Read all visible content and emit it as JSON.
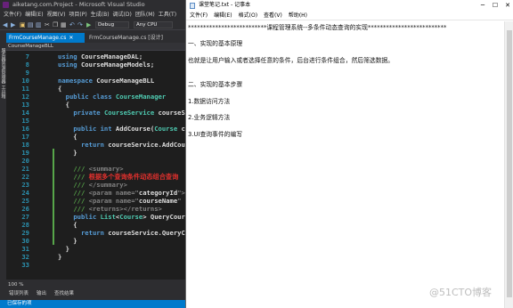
{
  "vs": {
    "title": "aiketang.com.Project - Microsoft Visual Studio",
    "menu": [
      "文件(F)",
      "编辑(E)",
      "视图(V)",
      "项目(P)",
      "生成(B)",
      "调试(D)",
      "团队(M)",
      "工具(T)"
    ],
    "config": "Debug",
    "platform": "Any CPU",
    "tabs": [
      {
        "label": "FrmCourseManage.cs",
        "active": true
      },
      {
        "label": "FrmCourseManage.cs [设计]",
        "active": false
      }
    ],
    "sidestrip_label": "服务器资源管理器 工具箱",
    "nav_class": "CourseManageBLL",
    "code": [
      {
        "n": "7",
        "parts": [
          [
            "kw",
            "using "
          ],
          [
            "",
            "CourseManageDAL;"
          ]
        ]
      },
      {
        "n": "8",
        "parts": [
          [
            "kw",
            "using "
          ],
          [
            "",
            "CourseManageModels;"
          ]
        ]
      },
      {
        "n": "9",
        "parts": []
      },
      {
        "n": "10",
        "parts": [
          [
            "kw",
            "namespace "
          ],
          [
            "",
            "CourseManageBLL"
          ]
        ]
      },
      {
        "n": "11",
        "parts": [
          [
            "",
            "{"
          ]
        ]
      },
      {
        "n": "12",
        "parts": [
          [
            "",
            "  "
          ],
          [
            "kw",
            "public class "
          ],
          [
            "ty",
            "CourseManager"
          ]
        ]
      },
      {
        "n": "13",
        "parts": [
          [
            "",
            "  {"
          ]
        ]
      },
      {
        "n": "14",
        "parts": [
          [
            "",
            "    "
          ],
          [
            "kw",
            "private "
          ],
          [
            "ty",
            "CourseService "
          ],
          [
            "",
            "courseS"
          ]
        ]
      },
      {
        "n": "15",
        "parts": []
      },
      {
        "n": "16",
        "parts": [
          [
            "",
            "    "
          ],
          [
            "kw",
            "public int "
          ],
          [
            "",
            "AddCourse("
          ],
          [
            "ty",
            "Course "
          ],
          [
            "",
            "co"
          ]
        ]
      },
      {
        "n": "17",
        "parts": [
          [
            "",
            "    {"
          ]
        ]
      },
      {
        "n": "18",
        "parts": [
          [
            "",
            "      "
          ],
          [
            "kw",
            "return "
          ],
          [
            "",
            "courseService.AddCou"
          ]
        ]
      },
      {
        "n": "19",
        "parts": [
          [
            "",
            "    }"
          ]
        ],
        "green": true
      },
      {
        "n": "20",
        "parts": [],
        "green": true
      },
      {
        "n": "21",
        "parts": [
          [
            "",
            "    "
          ],
          [
            "cm",
            "/// "
          ],
          [
            "xml",
            "<summary>"
          ]
        ],
        "green": true
      },
      {
        "n": "22",
        "parts": [
          [
            "",
            "    "
          ],
          [
            "cm",
            "/// "
          ],
          [
            "red",
            "根据多个查询条件动态组合查询"
          ]
        ],
        "green": true
      },
      {
        "n": "23",
        "parts": [
          [
            "",
            "    "
          ],
          [
            "cm",
            "/// "
          ],
          [
            "xml",
            "</summary>"
          ]
        ],
        "green": true
      },
      {
        "n": "24",
        "parts": [
          [
            "",
            "    "
          ],
          [
            "cm",
            "/// "
          ],
          [
            "xml",
            "<param name=\""
          ],
          [
            "",
            "categoryId"
          ],
          [
            "xml",
            "\">"
          ]
        ],
        "green": true
      },
      {
        "n": "25",
        "parts": [
          [
            "",
            "    "
          ],
          [
            "cm",
            "/// "
          ],
          [
            "xml",
            "<param name=\""
          ],
          [
            "",
            "courseName"
          ],
          [
            "xml",
            "\""
          ]
        ],
        "green": true
      },
      {
        "n": "26",
        "parts": [
          [
            "",
            "    "
          ],
          [
            "cm",
            "/// "
          ],
          [
            "xml",
            "<returns></returns>"
          ]
        ],
        "green": true
      },
      {
        "n": "27",
        "parts": [
          [
            "",
            "    "
          ],
          [
            "kw",
            "public "
          ],
          [
            "ty",
            "List"
          ],
          [
            "",
            "<"
          ],
          [
            "ty",
            "Course"
          ],
          [
            "",
            "> QueryCours"
          ]
        ],
        "green": true
      },
      {
        "n": "28",
        "parts": [
          [
            "",
            "    {"
          ]
        ],
        "green": true
      },
      {
        "n": "29",
        "parts": [
          [
            "",
            "      "
          ],
          [
            "kw",
            "return "
          ],
          [
            "",
            "courseService.QueryC"
          ]
        ],
        "green": true
      },
      {
        "n": "30",
        "parts": [
          [
            "",
            "    }"
          ]
        ],
        "green": true
      },
      {
        "n": "31",
        "parts": [
          [
            "",
            "  }"
          ]
        ]
      },
      {
        "n": "32",
        "parts": [
          [
            "",
            "}"
          ]
        ]
      },
      {
        "n": "33",
        "parts": []
      }
    ],
    "zoom": "100 %",
    "bottom_tabs": [
      "错误列表",
      "输出",
      "查找结果"
    ],
    "status": "已保存的项"
  },
  "notepad": {
    "title": "课堂笔记.txt - 记事本",
    "menu": [
      "文件(F)",
      "编辑(E)",
      "格式(O)",
      "查看(V)",
      "帮助(H)"
    ],
    "lines": [
      "**************************课程管理系统--多条件动态查询的实现**************************",
      "",
      "一、实现的基本原理",
      "",
      "也就是让用户输入或者选择任意的条件，后台进行条件组合，然后筛选数据。",
      "",
      "",
      "二、实现的基本步骤",
      "",
      "1.数据访问方法",
      "",
      "2.业务逻辑方法",
      "",
      "3.UI查询事件的编写"
    ]
  },
  "watermark": "@51CTO博客"
}
